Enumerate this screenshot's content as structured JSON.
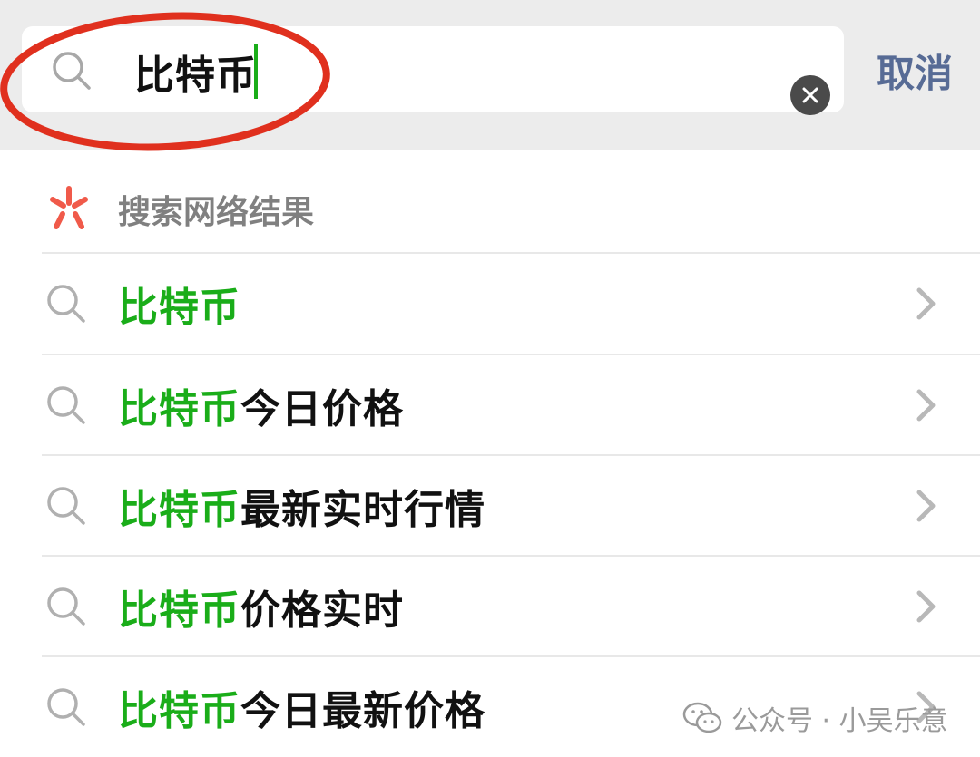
{
  "search": {
    "query": "比特币",
    "cancel_label": "取消"
  },
  "web_results_header": {
    "label": "搜索网络结果"
  },
  "suggestions": [
    {
      "highlight": "比特币",
      "rest": ""
    },
    {
      "highlight": "比特币",
      "rest": "今日价格"
    },
    {
      "highlight": "比特币",
      "rest": "最新实时行情"
    },
    {
      "highlight": "比特币",
      "rest": "价格实时"
    },
    {
      "highlight": "比特币",
      "rest": "今日最新价格"
    }
  ],
  "watermark": {
    "text": "公众号 · 小吴乐意"
  },
  "icons": {
    "search": "search-icon",
    "clear": "clear-icon",
    "web": "ai-search-icon",
    "chevron": "chevron-right-icon",
    "wechat": "wechat-icon"
  },
  "colors": {
    "highlight": "#1aad19",
    "cancel": "#576b95",
    "annotation": "#e0301e",
    "topbar": "#ececec"
  }
}
